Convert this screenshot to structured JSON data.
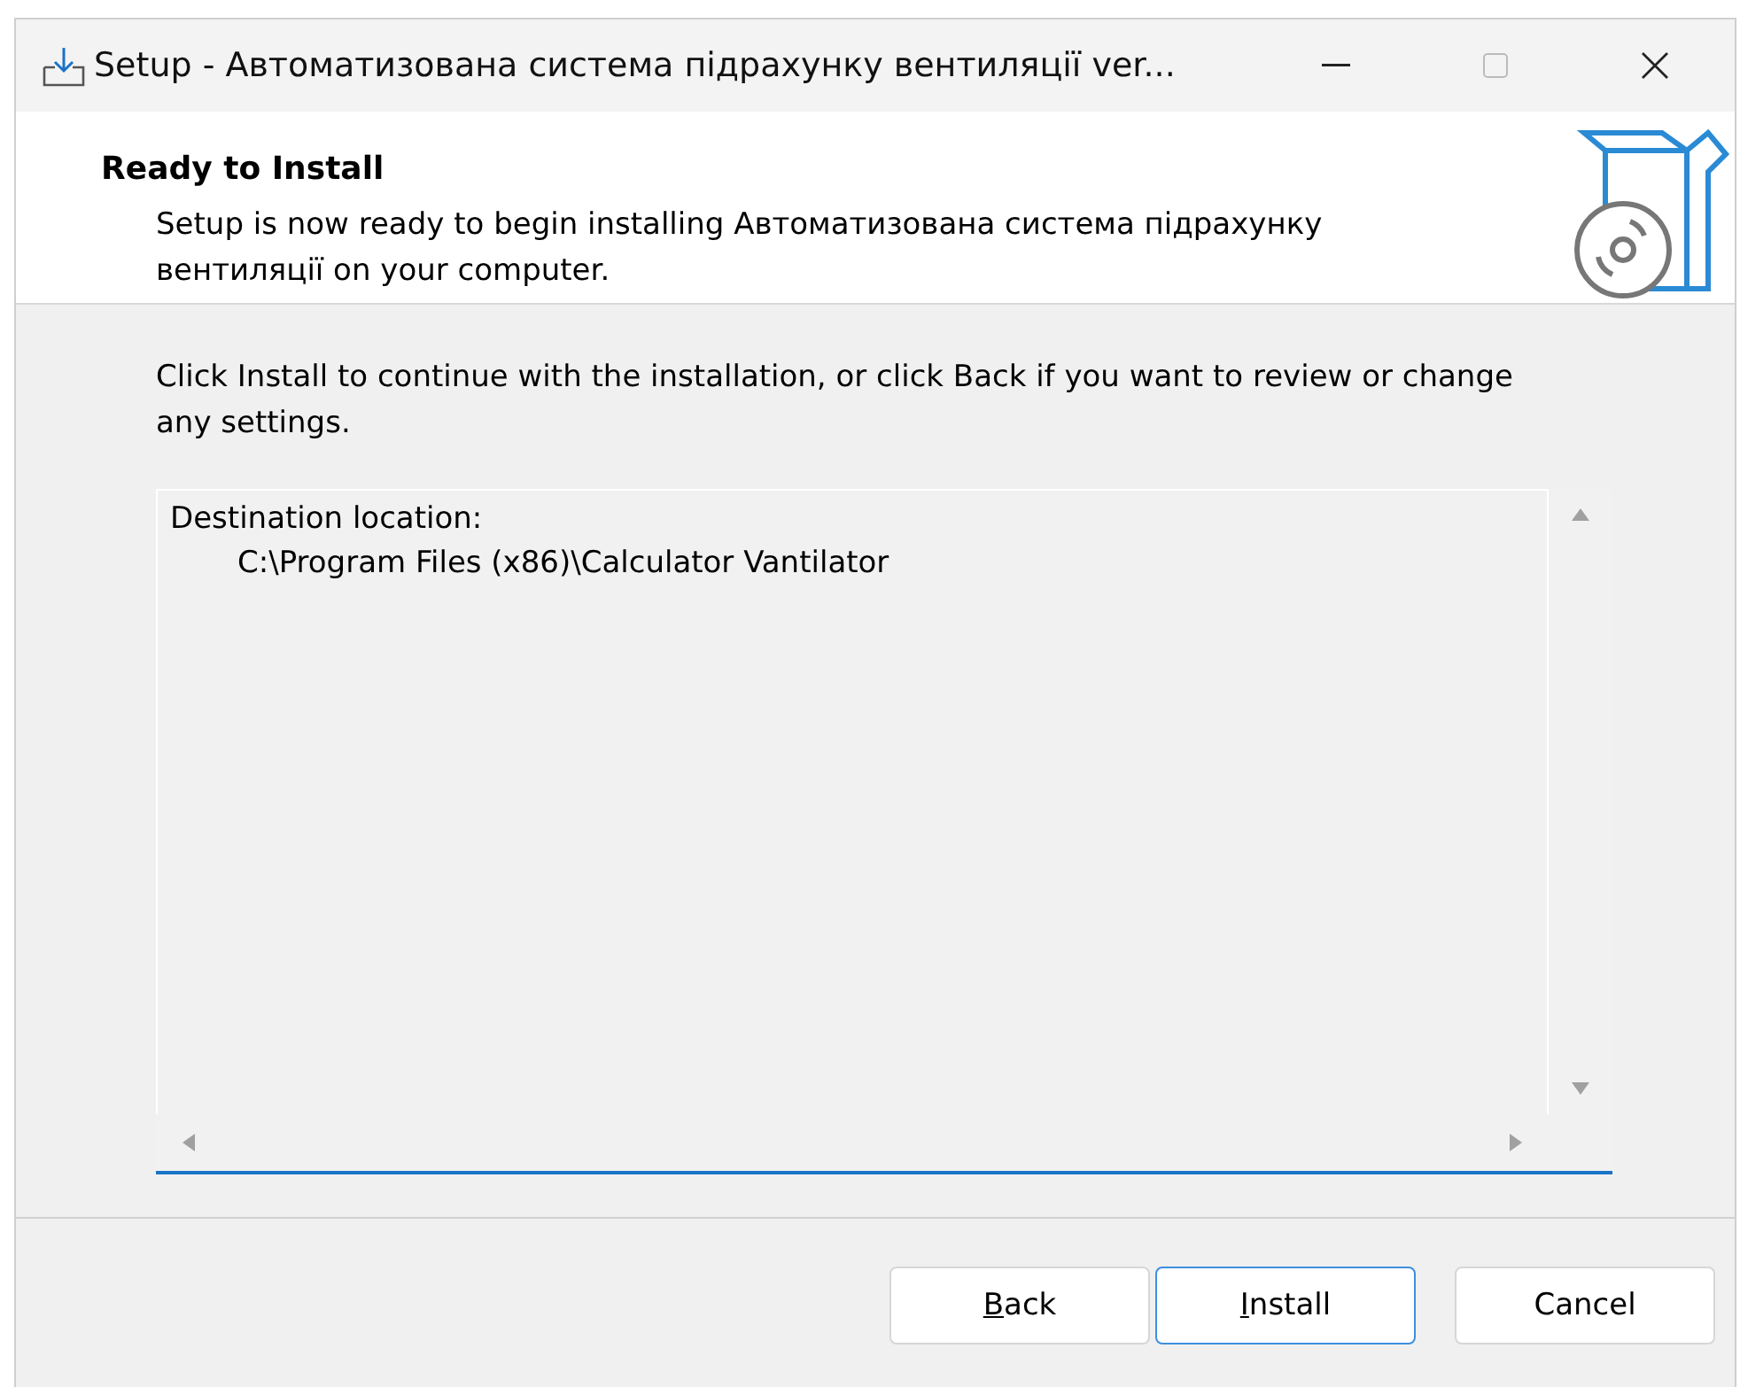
{
  "window": {
    "title": "Setup - Автоматизована система підрахунку вентиляції ver..."
  },
  "header": {
    "title": "Ready to Install",
    "subtitle": "Setup is now ready to begin installing Автоматизована система підрахунку вентиляції on your computer."
  },
  "instructions": "Click Install to continue with the installation, or click Back if you want to review or change any settings.",
  "summary": {
    "lines": [
      {
        "text": "Destination location:",
        "indented": false
      },
      {
        "text": "C:\\Program Files (x86)\\Calculator Vantilator",
        "indented": true
      }
    ]
  },
  "buttons": [
    {
      "label": "Back",
      "access_key_underlined": true,
      "default": false
    },
    {
      "label": "Install",
      "access_key_underlined": true,
      "default": true
    },
    {
      "label": "Cancel",
      "access_key_underlined": false,
      "default": false
    }
  ]
}
